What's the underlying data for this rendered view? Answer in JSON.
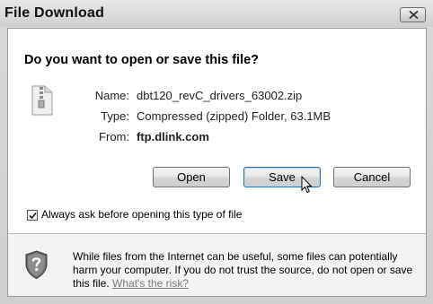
{
  "window": {
    "title": "File Download",
    "close_icon": "close-icon"
  },
  "prompt": {
    "heading": "Do you want to open or save this file?"
  },
  "file": {
    "icon": "zip-folder-icon",
    "name_label": "Name:",
    "name_value": "dbt120_revC_drivers_63002.zip",
    "type_label": "Type:",
    "type_value": "Compressed (zipped) Folder, 63.1MB",
    "from_label": "From:",
    "from_value": "ftp.dlink.com"
  },
  "buttons": {
    "open_label": "Open",
    "save_label": "Save",
    "cancel_label": "Cancel"
  },
  "checkbox": {
    "label": "Always ask before opening this type of file",
    "checked": true
  },
  "warning": {
    "icon": "shield-warning-icon",
    "text": "While files from the Internet can be useful, some files can potentially harm your computer. If you do not trust the source, do not open or save this file.",
    "link_label": "What's the risk?"
  },
  "colors": {
    "accent": "#2b6ea8",
    "link": "#7b7b7b"
  }
}
